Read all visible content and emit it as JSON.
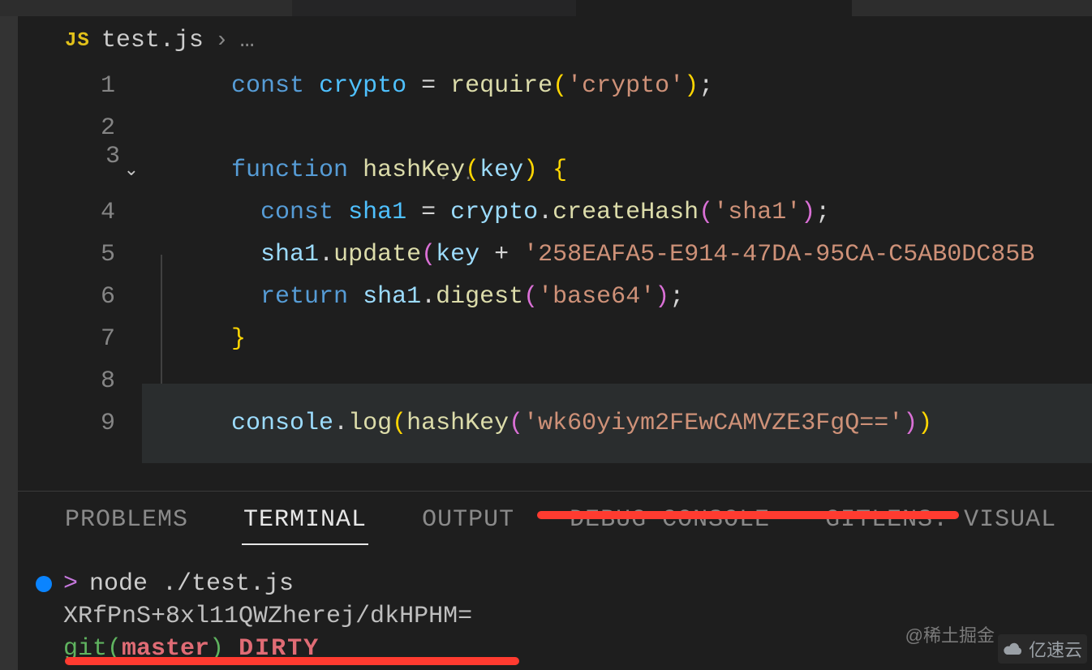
{
  "breadcrumb": {
    "js_badge": "JS",
    "filename": "test.js",
    "separator": "›",
    "ellipsis": "…"
  },
  "code": {
    "lines": [
      {
        "n": "1"
      },
      {
        "n": "2"
      },
      {
        "n": "3"
      },
      {
        "n": "4"
      },
      {
        "n": "5"
      },
      {
        "n": "6"
      },
      {
        "n": "7"
      },
      {
        "n": "8"
      },
      {
        "n": "9"
      }
    ],
    "tokens": {
      "const": "const",
      "crypto": "crypto",
      "eq": " = ",
      "require": "require",
      "str_crypto": "'crypto'",
      "semi": ";",
      "function": "function",
      "hashKey": "hashKey",
      "key": "key",
      "lbrace": "{",
      "rbrace": "}",
      "sha1": "sha1",
      "createHash": "createHash",
      "str_sha1": "'sha1'",
      "update": "update",
      "plus": " + ",
      "str_guid": "'258EAFA5-E914-47DA-95CA-C5AB0DC85B",
      "return": "return",
      "digest": "digest",
      "str_base64": "'base64'",
      "console": "console",
      "log": "log",
      "str_arg": "'wk60yiym2FEwCAMVZE3FgQ=='"
    },
    "hint_dots": "..."
  },
  "panel": {
    "tabs": {
      "problems": "PROBLEMS",
      "terminal": "TERMINAL",
      "output": "OUTPUT",
      "debug": "DEBUG CONSOLE",
      "gitlens": "GITLENS: VISUAL"
    }
  },
  "terminal": {
    "prompt": ">",
    "command": "node ./test.js",
    "output": "XRfPnS+8xl11QWZherej/dkHPHM=",
    "git_prefix": "git(",
    "git_branch": "master",
    "git_suffix": ")",
    "git_dirty": "DIRTY"
  },
  "watermarks": {
    "juejin": "@稀土掘金",
    "yisu": "亿速云"
  }
}
